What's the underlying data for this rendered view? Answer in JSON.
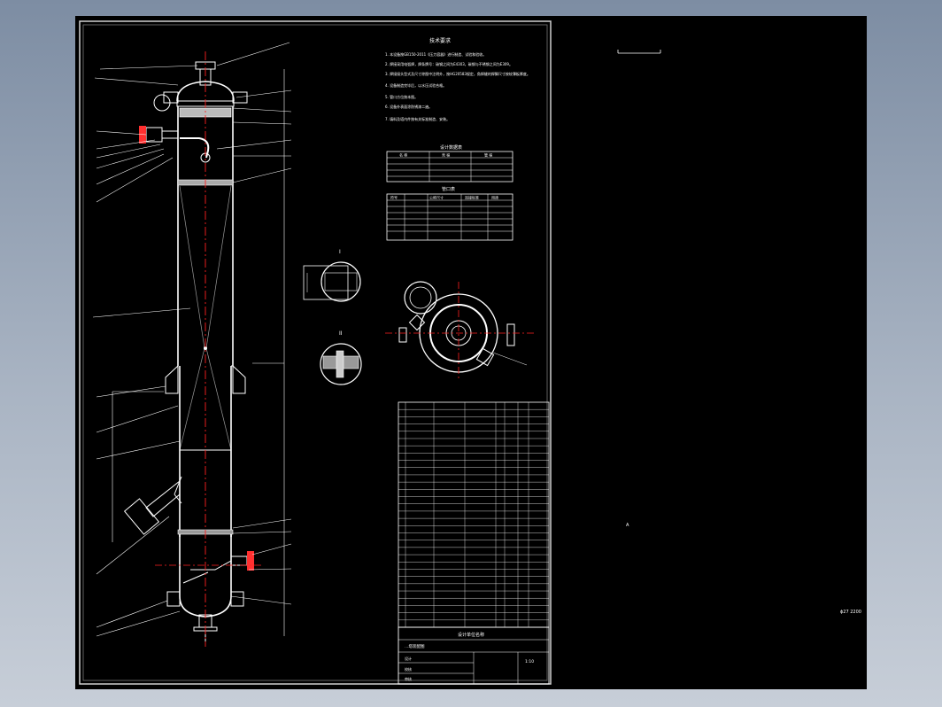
{
  "drawing": {
    "title": "…塔装配图",
    "notes_heading": "技术要求",
    "notes": [
      "1. 本设备按GB150-2011《压力容器》进行制造、试验和验收。",
      "2. 焊接采用电弧焊，焊条牌号：碳钢之间为E4303，碳钢与不锈钢之间为E309。",
      "3. 焊接接头型式及尺寸除图中注明外，按HG20583规定，角焊缝的焊脚尺寸按较薄板厚度。",
      "4. 设备制造完毕后，以水压试验合格。",
      "5. 管口方位按本图。",
      "6. 设备外表面涂防锈漆二遍。",
      "7. 填料及塔内件按有关标准制造、安装。"
    ],
    "design_table_title": "设计数据表",
    "design_headers": [
      "名 称",
      "壳 程",
      "管 程"
    ],
    "design_rows": [
      [
        "",
        "",
        ""
      ],
      [
        "",
        "",
        ""
      ],
      [
        "",
        "",
        ""
      ],
      [
        "",
        "",
        ""
      ]
    ],
    "nozzle_table_title": "管口表",
    "nozzle_headers": [
      "符号",
      "公称尺寸",
      "连接标准",
      "用途"
    ],
    "nozzle_rows": [
      [
        "",
        "",
        "",
        ""
      ],
      [
        "",
        "",
        "",
        ""
      ],
      [
        "",
        "",
        "",
        ""
      ],
      [
        "",
        "",
        "",
        ""
      ],
      [
        "",
        "",
        "",
        ""
      ],
      [
        "",
        "",
        "",
        ""
      ],
      [
        "",
        "",
        "",
        ""
      ]
    ],
    "view_labels": {
      "detail_i": "I",
      "detail_ii": "II",
      "side_label": "A",
      "far_right_mark": "ϕ27 2200"
    },
    "title_block": {
      "label": "设计单位名称",
      "rows": [
        "设计",
        "校核",
        "审核",
        "批准"
      ],
      "scale": "1:10"
    },
    "colors": {
      "background": "#000000",
      "line": "#ffffff",
      "center": "#ff2020",
      "border": "#d0d0d0"
    }
  }
}
